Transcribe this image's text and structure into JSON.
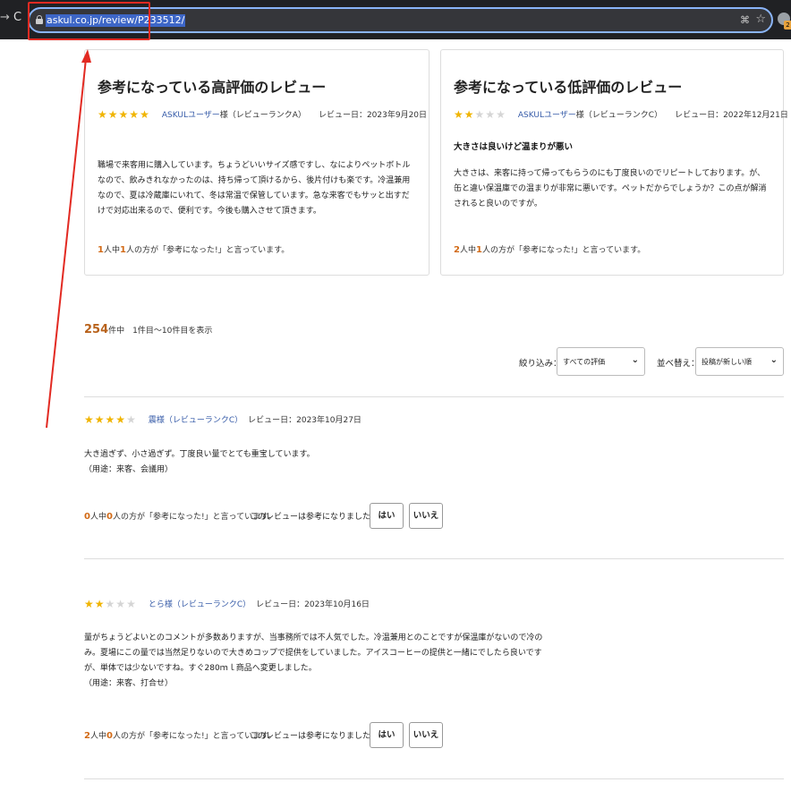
{
  "browser": {
    "url": "askul.co.jp/review/P233512/",
    "nav_back_icon": "→",
    "reload_icon": "C",
    "qr_icon": "⌘",
    "bookmark_icon": "☆",
    "extension_badge": "2"
  },
  "annotation": {
    "color": "#e22a22"
  },
  "top_reviews": {
    "positive": {
      "heading": "参考になっている高評価のレビュー",
      "rating": 5,
      "user": "ASKULユーザー",
      "user_suffix": "様（レビューランクA）",
      "date": "レビュー日：2023年9月20日",
      "body": "職場で来客用に購入しています。ちょうどいいサイズ感ですし、なによりペットボトルなので、飲みきれなかったのは、持ち帰って頂けるから、後片付けも楽です。冷温兼用なので、夏は冷蔵庫にいれて、冬は常温で保管しています。急な来客でもサッと出すだけで対応出来るので、便利です。今後も購入させて頂きます。",
      "helpful_total": "1",
      "helpful_mid": "人中",
      "helpful_count": "1",
      "helpful_text": "人の方が「参考になった!」と言っています。"
    },
    "negative": {
      "heading": "参考になっている低評価のレビュー",
      "rating": 2,
      "user": "ASKULユーザー",
      "user_suffix": "様（レビューランクC）",
      "date": "レビュー日：2022年12月21日",
      "headline": "大きさは良いけど温まりが悪い",
      "body": "大きさは、来客に持って帰ってもらうのにも丁度良いのでリピートしております。が、缶と違い保温庫での温まりが非常に悪いです。ペットだからでしょうか？この点が解消されると良いのですが。",
      "helpful_total": "2",
      "helpful_mid": "人中",
      "helpful_count": "1",
      "helpful_text": "人の方が「参考になった!」と言っています。"
    }
  },
  "summary": {
    "total": "254",
    "text": "件中　1件目～10件目を表示"
  },
  "filters": {
    "filter_label": "絞り込み：",
    "filter_value": "すべての評価",
    "sort_label": "並べ替え：",
    "sort_value": "投稿が新しい順",
    "chevron_icon": "⌄"
  },
  "reviews": [
    {
      "rating": 4,
      "user": "震様（レビューランクC）",
      "date": "レビュー日：2023年10月27日",
      "body": "大き過ぎず、小さ過ぎず。丁度良い量でとても重宝しています。",
      "usage": "（用途：来客、会議用）",
      "helpful_total": "0",
      "helpful_mid": "人中",
      "helpful_count": "0",
      "helpful_text": "人の方が「参考になった!」と言っています。",
      "ask": "このレビューは参考になりましたか？",
      "yes": "はい",
      "no": "いいえ"
    },
    {
      "rating": 2,
      "user": "とら様（レビューランクC）",
      "date": "レビュー日：2023年10月16日",
      "body": "量がちょうどよいとのコメントが多数ありますが、当事務所では不人気でした。冷温兼用とのことですが保温庫がないので冷のみ。夏場にこの量では当然足りないので大きめコップで提供をしていました。アイスコーヒーの提供と一緒にでしたら良いですが、単体では少ないですね。すぐ280ｍｌ商品へ変更しました。",
      "usage": "（用途：来客、打合せ）",
      "helpful_total": "2",
      "helpful_mid": "人中",
      "helpful_count": "0",
      "helpful_text": "人の方が「参考になった!」と言っています。",
      "ask": "このレビューは参考になりましたか？",
      "yes": "はい",
      "no": "いいえ"
    }
  ]
}
